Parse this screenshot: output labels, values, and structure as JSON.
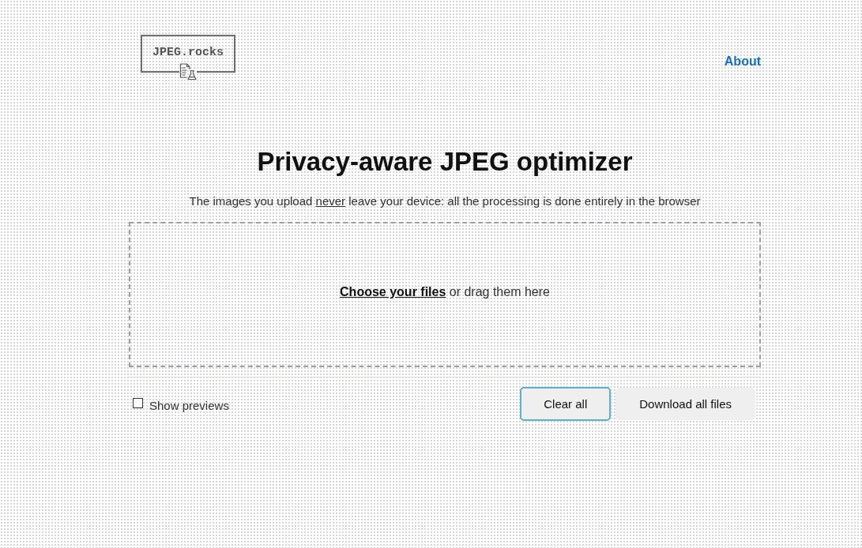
{
  "header": {
    "logo": "JPEG.rocks",
    "nav": [
      {
        "label": "About"
      }
    ]
  },
  "hero": {
    "title": "Privacy-aware JPEG optimizer",
    "subtitle": {
      "before": "The images you upload",
      "underlined": "never",
      "after": "leave your device: all the processing is done entirely in the browser"
    }
  },
  "dropzone": {
    "link": "Choose your files",
    "text": "or drag them here"
  },
  "options": {
    "show_previews": {
      "label": "Show previews",
      "checked": false
    }
  },
  "buttons": [
    {
      "label": "Clear all",
      "focused": true
    },
    {
      "label": "Download all files",
      "focused": false
    }
  ]
}
